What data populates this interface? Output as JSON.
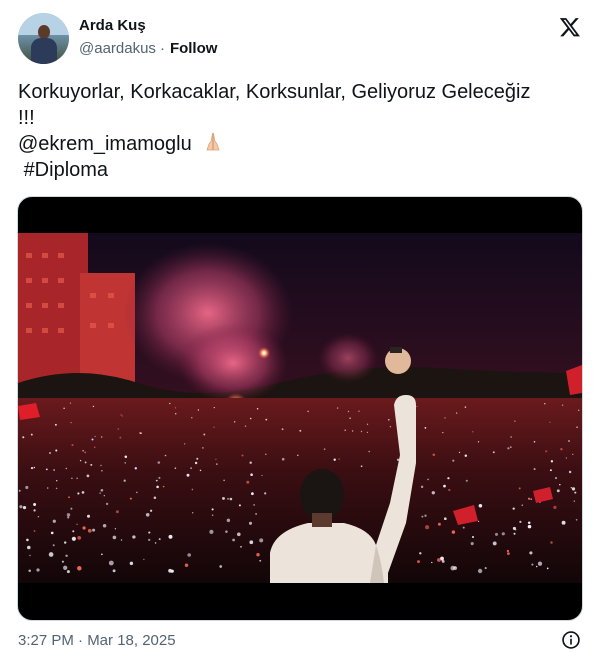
{
  "author": {
    "name": "Arda Kuş",
    "handle": "@aardakus",
    "separator": "·",
    "follow_label": "Follow"
  },
  "tweet": {
    "line1": "Korkuyorlar, Korkacaklar, Korksunlar, Geliyoruz Geleceğiz",
    "line2": "!!!",
    "mention": "@ekrem_imamoglu",
    "hashtag": "#Diploma"
  },
  "footer": {
    "timestamp": "3:27 PM · Mar 18, 2025"
  },
  "icons": {
    "brand": "x-logo-icon",
    "info": "info-icon",
    "emoji": "folded-hands-emoji"
  },
  "colors": {
    "text_primary": "#0f1419",
    "text_secondary": "#536471",
    "media_border": "#cfd9de"
  }
}
